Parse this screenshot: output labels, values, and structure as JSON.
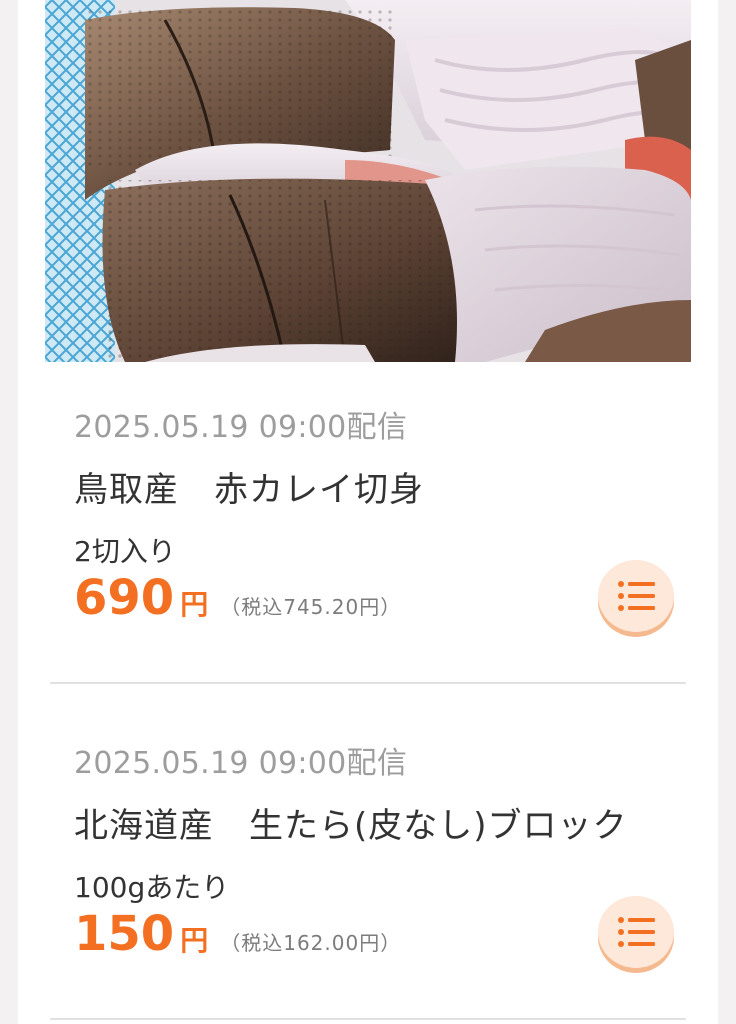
{
  "colors": {
    "accent": "#f36f21",
    "button_bg": "#fde8d9",
    "muted_text": "#9d9d9d"
  },
  "items": [
    {
      "datetime": "2025.05.19 09:00配信",
      "title": "鳥取産　赤カレイ切身",
      "unit": "2切入り",
      "price": "690",
      "currency": "円",
      "tax_included": "（税込745.20円）",
      "action_icon": "list-icon"
    },
    {
      "datetime": "2025.05.19 09:00配信",
      "title": "北海道産　生たら(皮なし)ブロック",
      "unit": "100gあたり",
      "price": "150",
      "currency": "円",
      "tax_included": "（税込162.00円）",
      "action_icon": "list-icon"
    }
  ]
}
